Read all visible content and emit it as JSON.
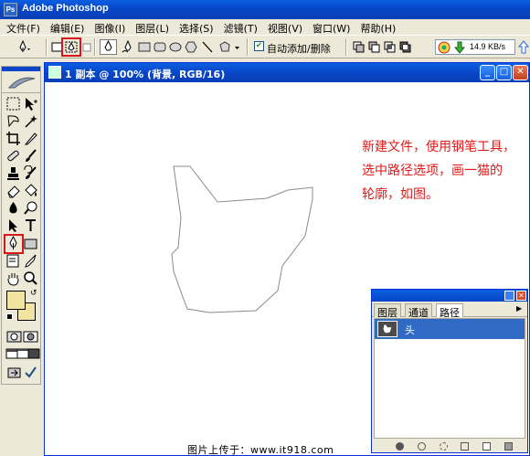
{
  "app": {
    "title": "Adobe Photoshop",
    "icon": "Ps"
  },
  "menu": [
    "文件(F)",
    "编辑(E)",
    "图像(I)",
    "图层(L)",
    "选择(S)",
    "滤镜(T)",
    "视图(V)",
    "窗口(W)",
    "帮助(H)"
  ],
  "options": {
    "auto_add_delete": "自动添加/删除",
    "speed": "14.9 KB/s"
  },
  "document": {
    "title": "1 副本 @ 100% (背景, RGB/16)"
  },
  "annotation": [
    "新建文件，使用钢笔工具，",
    "选中路径选项，画一猫的",
    "轮廓，如图。"
  ],
  "paths_panel": {
    "tabs": [
      "图层",
      "通道",
      "路径"
    ],
    "active_tab": "路径",
    "items": [
      {
        "name": "头"
      }
    ]
  },
  "credit": "图片上传于：www.it918.com",
  "colors": {
    "annotation": "#e01818",
    "highlight": "#d8141c",
    "foreground": "#f0e4a0",
    "selection": "#316ac5"
  }
}
